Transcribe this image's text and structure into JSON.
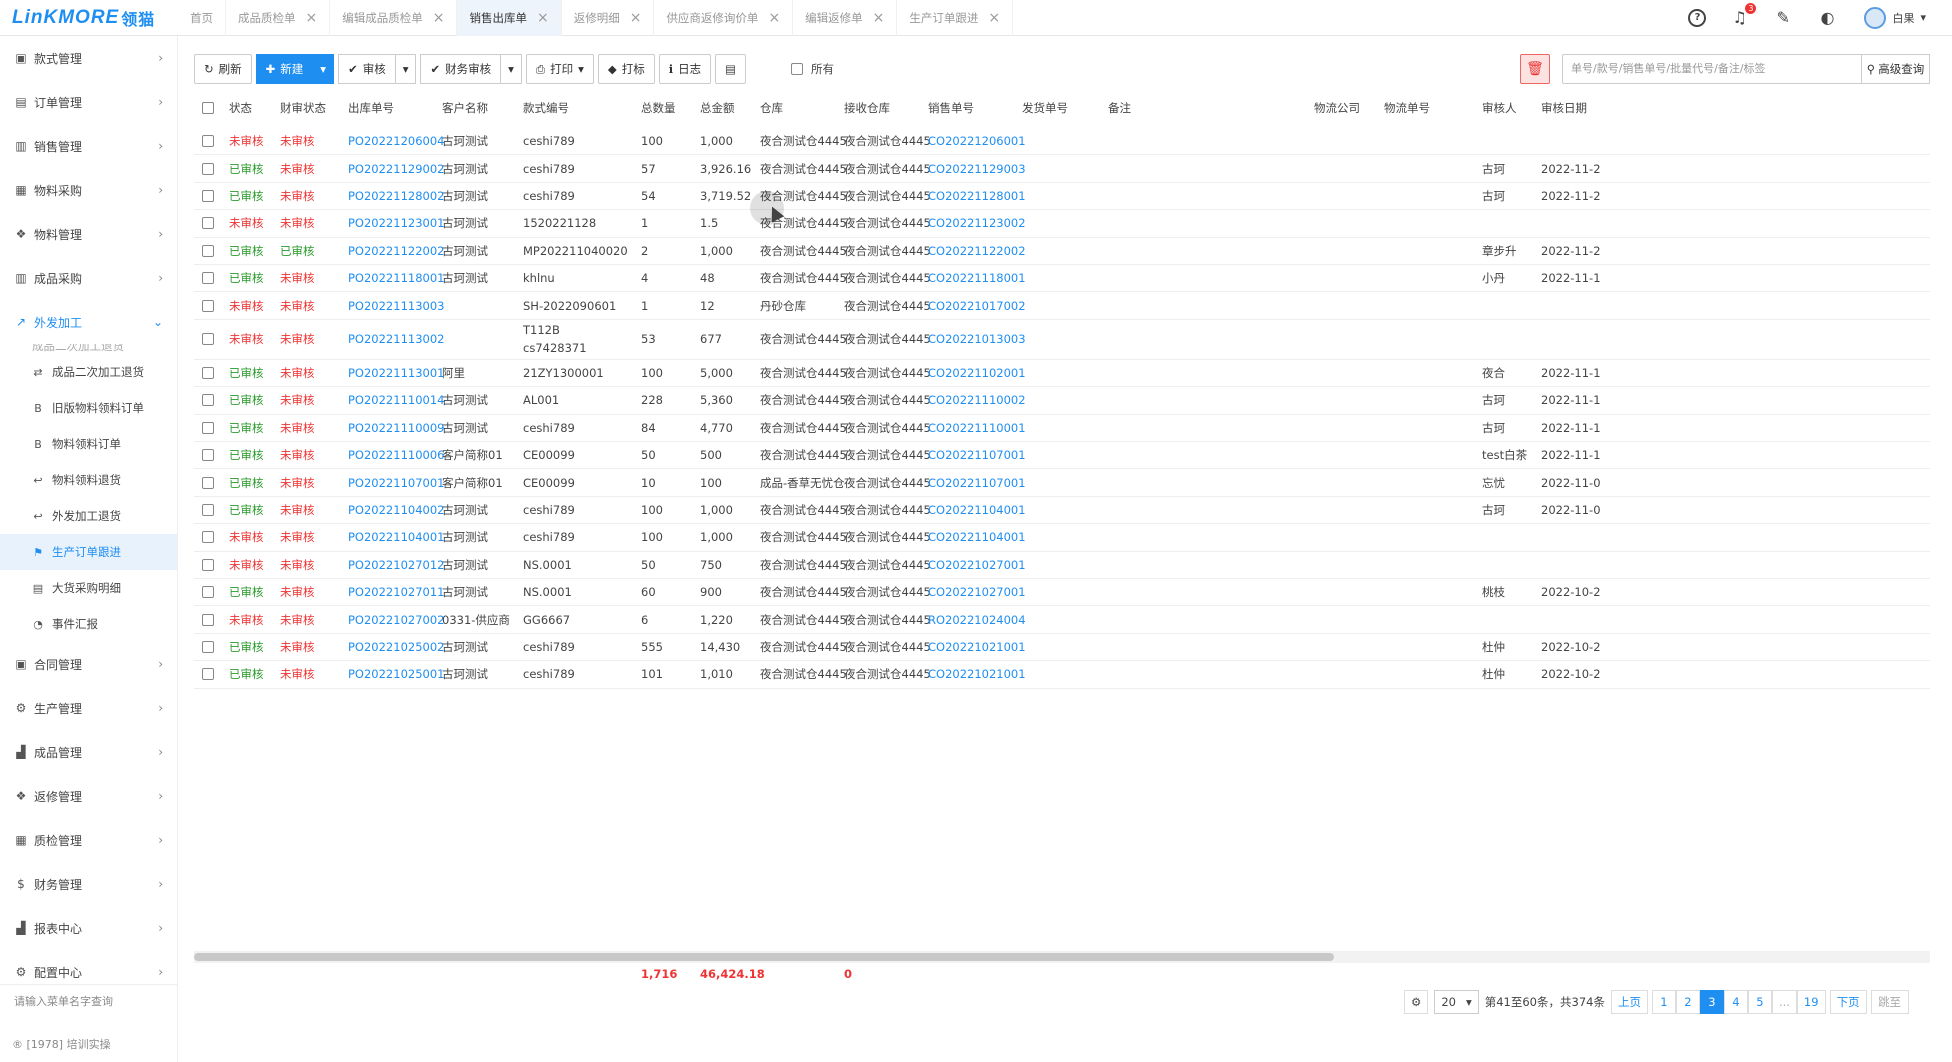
{
  "brand": {
    "logo": "LinKMORE",
    "logo_cn": "领猫"
  },
  "tabs": [
    {
      "label": "首页",
      "closable": false,
      "active": false
    },
    {
      "label": "成品质检单",
      "closable": true,
      "active": false
    },
    {
      "label": "编辑成品质检单",
      "closable": true,
      "active": false
    },
    {
      "label": "销售出库单",
      "closable": true,
      "active": true
    },
    {
      "label": "返修明细",
      "closable": true,
      "active": false
    },
    {
      "label": "供应商返修询价单",
      "closable": true,
      "active": false
    },
    {
      "label": "编辑返修单",
      "closable": true,
      "active": false
    },
    {
      "label": "生产订单跟进",
      "closable": true,
      "active": false
    }
  ],
  "header": {
    "help": "?",
    "notif_count": "3",
    "user_name": "白果"
  },
  "sidebar": {
    "items_top": [
      {
        "label": "款式管理",
        "icon": "shirt-icon",
        "glyph": "▣"
      },
      {
        "label": "订单管理",
        "icon": "document-icon",
        "glyph": "▤"
      },
      {
        "label": "销售管理",
        "icon": "bank-icon",
        "glyph": "▥"
      },
      {
        "label": "物料采购",
        "icon": "truck-icon",
        "glyph": "▦"
      },
      {
        "label": "物料管理",
        "icon": "cubes-icon",
        "glyph": "❖"
      },
      {
        "label": "成品采购",
        "icon": "bank-icon",
        "glyph": "▥"
      },
      {
        "label": "外发加工",
        "icon": "external-link-icon",
        "glyph": "↗",
        "open": true
      }
    ],
    "sub_cut": "成品二次加工退货",
    "sub_items": [
      {
        "label": "成品二次加工退货",
        "icon": "exchange-icon",
        "glyph": "⇄"
      },
      {
        "label": "旧版物料领料订单",
        "icon": "bitcoin-icon",
        "glyph": "B"
      },
      {
        "label": "物料领料订单",
        "icon": "bitcoin-icon",
        "glyph": "B"
      },
      {
        "label": "物料领料退货",
        "icon": "reply-icon",
        "glyph": "↩"
      },
      {
        "label": "外发加工退货",
        "icon": "reply-icon",
        "glyph": "↩"
      },
      {
        "label": "生产订单跟进",
        "icon": "flag-icon",
        "glyph": "⚑",
        "active": true
      },
      {
        "label": "大货采购明细",
        "icon": "file-icon",
        "glyph": "▤"
      },
      {
        "label": "事件汇报",
        "icon": "clock-icon",
        "glyph": "◔"
      }
    ],
    "items_bottom": [
      {
        "label": "合同管理",
        "icon": "contract-icon",
        "glyph": "▣"
      },
      {
        "label": "生产管理",
        "icon": "gears-icon",
        "glyph": "⚙"
      },
      {
        "label": "成品管理",
        "icon": "chart-icon",
        "glyph": "▟"
      },
      {
        "label": "返修管理",
        "icon": "cubes-icon",
        "glyph": "❖"
      },
      {
        "label": "质检管理",
        "icon": "barcode-icon",
        "glyph": "▦"
      },
      {
        "label": "财务管理",
        "icon": "dollar-icon",
        "glyph": "$"
      },
      {
        "label": "报表中心",
        "icon": "bar-chart-icon",
        "glyph": "▟"
      },
      {
        "label": "配置中心",
        "icon": "gears-icon",
        "glyph": "⚙"
      }
    ],
    "search_placeholder": "请输入菜单名字查询",
    "footer": "[1978] 培训实操"
  },
  "toolbar": {
    "refresh": "刷新",
    "new": "新建",
    "audit": "审核",
    "finance_audit": "财务审核",
    "print": "打印",
    "tag": "打标",
    "log": "日志",
    "all_label": "所有",
    "search_placeholder": "单号/款号/销售单号/批量代号/备注/标签",
    "advanced": "高级查询"
  },
  "columns": [
    "状态",
    "财审状态",
    "出库单号",
    "客户名称",
    "款式编号",
    "总数量",
    "总金额",
    "仓库",
    "接收仓库",
    "销售单号",
    "发货单号",
    "备注",
    "物流公司",
    "物流单号",
    "审核人",
    "审核日期"
  ],
  "rows": [
    {
      "status": "未审核",
      "fin": "未审核",
      "no": "PO20221206004",
      "cust": "古珂测试",
      "style": "ceshi789",
      "qty": "100",
      "amt": "1,000",
      "wh": "夜合测试仓4445",
      "recv": "夜合测试仓4445",
      "so": "CO20221206001",
      "auditor": "",
      "date": ""
    },
    {
      "status": "已审核",
      "fin": "未审核",
      "no": "PO20221129002",
      "cust": "古珂测试",
      "style": "ceshi789",
      "qty": "57",
      "amt": "3,926.16",
      "wh": "夜合测试仓4445",
      "recv": "夜合测试仓4445",
      "so": "CO20221129003",
      "auditor": "古珂",
      "date": "2022-11-2"
    },
    {
      "status": "已审核",
      "fin": "未审核",
      "no": "PO20221128002",
      "cust": "古珂测试",
      "style": "ceshi789",
      "qty": "54",
      "amt": "3,719.52",
      "wh": "夜合测试仓4445",
      "recv": "夜合测试仓4445",
      "so": "CO20221128001",
      "auditor": "古珂",
      "date": "2022-11-2"
    },
    {
      "status": "未审核",
      "fin": "未审核",
      "no": "PO20221123001",
      "cust": "古珂测试",
      "style": "1520221128",
      "qty": "1",
      "amt": "1.5",
      "wh": "夜合测试仓4445",
      "recv": "夜合测试仓4445",
      "so": "CO20221123002",
      "auditor": "",
      "date": ""
    },
    {
      "status": "已审核",
      "fin": "已审核",
      "no": "PO20221122002",
      "cust": "古珂测试",
      "style": "MP202211040020",
      "qty": "2",
      "amt": "1,000",
      "wh": "夜合测试仓4445",
      "recv": "夜合测试仓4445",
      "so": "CO20221122002",
      "auditor": "章步升",
      "date": "2022-11-2"
    },
    {
      "status": "已审核",
      "fin": "未审核",
      "no": "PO20221118001",
      "cust": "古珂测试",
      "style": "khlnu",
      "qty": "4",
      "amt": "48",
      "wh": "夜合测试仓4445",
      "recv": "夜合测试仓4445",
      "so": "CO20221118001",
      "auditor": "小丹",
      "date": "2022-11-1"
    },
    {
      "status": "未审核",
      "fin": "未审核",
      "no": "PO20221113003",
      "cust": "",
      "style": "SH-2022090601",
      "qty": "1",
      "amt": "12",
      "wh": "丹砂仓库",
      "recv": "夜合测试仓4445",
      "so": "CO20221017002",
      "auditor": "",
      "date": ""
    },
    {
      "status": "未审核",
      "fin": "未审核",
      "no": "PO20221113002",
      "cust": "",
      "style": "T112B",
      "style2": "cs7428371",
      "qty": "53",
      "amt": "677",
      "wh": "夜合测试仓4445",
      "recv": "夜合测试仓4445",
      "so": "CO20221013003",
      "auditor": "",
      "date": "",
      "tall": true
    },
    {
      "status": "已审核",
      "fin": "未审核",
      "no": "PO20221113001",
      "cust": "阿里",
      "style": "21ZY1300001",
      "qty": "100",
      "amt": "5,000",
      "wh": "夜合测试仓4445",
      "recv": "夜合测试仓4445",
      "so": "CO20221102001",
      "auditor": "夜合",
      "date": "2022-11-1"
    },
    {
      "status": "已审核",
      "fin": "未审核",
      "no": "PO20221110014",
      "cust": "古珂测试",
      "style": "AL001",
      "qty": "228",
      "amt": "5,360",
      "wh": "夜合测试仓4445",
      "recv": "夜合测试仓4445",
      "so": "CO20221110002",
      "auditor": "古珂",
      "date": "2022-11-1"
    },
    {
      "status": "已审核",
      "fin": "未审核",
      "no": "PO20221110009",
      "cust": "古珂测试",
      "style": "ceshi789",
      "qty": "84",
      "amt": "4,770",
      "wh": "夜合测试仓4445",
      "recv": "夜合测试仓4445",
      "so": "CO20221110001",
      "auditor": "古珂",
      "date": "2022-11-1"
    },
    {
      "status": "已审核",
      "fin": "未审核",
      "no": "PO20221110006",
      "cust": "客户简称01",
      "style": "CE00099",
      "qty": "50",
      "amt": "500",
      "wh": "夜合测试仓4445",
      "recv": "夜合测试仓4445",
      "so": "CO20221107001",
      "auditor": "test白茶",
      "date": "2022-11-1"
    },
    {
      "status": "已审核",
      "fin": "未审核",
      "no": "PO20221107001",
      "cust": "客户简称01",
      "style": "CE00099",
      "qty": "10",
      "amt": "100",
      "wh": "成品-香草无忧仓",
      "recv": "夜合测试仓4445",
      "so": "CO20221107001",
      "auditor": "忘忧",
      "date": "2022-11-0"
    },
    {
      "status": "已审核",
      "fin": "未审核",
      "no": "PO20221104002",
      "cust": "古珂测试",
      "style": "ceshi789",
      "qty": "100",
      "amt": "1,000",
      "wh": "夜合测试仓4445",
      "recv": "夜合测试仓4445",
      "so": "CO20221104001",
      "auditor": "古珂",
      "date": "2022-11-0"
    },
    {
      "status": "未审核",
      "fin": "未审核",
      "no": "PO20221104001",
      "cust": "古珂测试",
      "style": "ceshi789",
      "qty": "100",
      "amt": "1,000",
      "wh": "夜合测试仓4445",
      "recv": "夜合测试仓4445",
      "so": "CO20221104001",
      "auditor": "",
      "date": ""
    },
    {
      "status": "未审核",
      "fin": "未审核",
      "no": "PO20221027012",
      "cust": "古珂测试",
      "style": "NS.0001",
      "qty": "50",
      "amt": "750",
      "wh": "夜合测试仓4445",
      "recv": "夜合测试仓4445",
      "so": "CO20221027001",
      "auditor": "",
      "date": ""
    },
    {
      "status": "已审核",
      "fin": "未审核",
      "no": "PO20221027011",
      "cust": "古珂测试",
      "style": "NS.0001",
      "qty": "60",
      "amt": "900",
      "wh": "夜合测试仓4445",
      "recv": "夜合测试仓4445",
      "so": "CO20221027001",
      "auditor": "桃枝",
      "date": "2022-10-2"
    },
    {
      "status": "未审核",
      "fin": "未审核",
      "no": "PO20221027002",
      "cust": "0331-供应商",
      "style": "GG6667",
      "qty": "6",
      "amt": "1,220",
      "wh": "夜合测试仓4445",
      "recv": "夜合测试仓4445",
      "so": "RO20221024004",
      "auditor": "",
      "date": ""
    },
    {
      "status": "已审核",
      "fin": "未审核",
      "no": "PO20221025002",
      "cust": "古珂测试",
      "style": "ceshi789",
      "qty": "555",
      "amt": "14,430",
      "wh": "夜合测试仓4445",
      "recv": "夜合测试仓4445",
      "so": "CO20221021001",
      "auditor": "杜仲",
      "date": "2022-10-2"
    },
    {
      "status": "已审核",
      "fin": "未审核",
      "no": "PO20221025001",
      "cust": "古珂测试",
      "style": "ceshi789",
      "qty": "101",
      "amt": "1,010",
      "wh": "夜合测试仓4445",
      "recv": "夜合测试仓4445",
      "so": "CO20221021001",
      "auditor": "杜仲",
      "date": "2022-10-2"
    }
  ],
  "totals": {
    "qty": "1,716",
    "amt": "46,424.18",
    "ship": "0"
  },
  "pager": {
    "size": "20",
    "info": "第41至60条，共374条",
    "prev": "上页",
    "pages": [
      "1",
      "2",
      "3",
      "4",
      "5",
      "...",
      "19"
    ],
    "current": "3",
    "next": "下页",
    "jump": "跳至"
  },
  "colors": {
    "accent": "#1f8ef1",
    "unaudited": "#e33333",
    "audited": "#2a9a2a"
  }
}
